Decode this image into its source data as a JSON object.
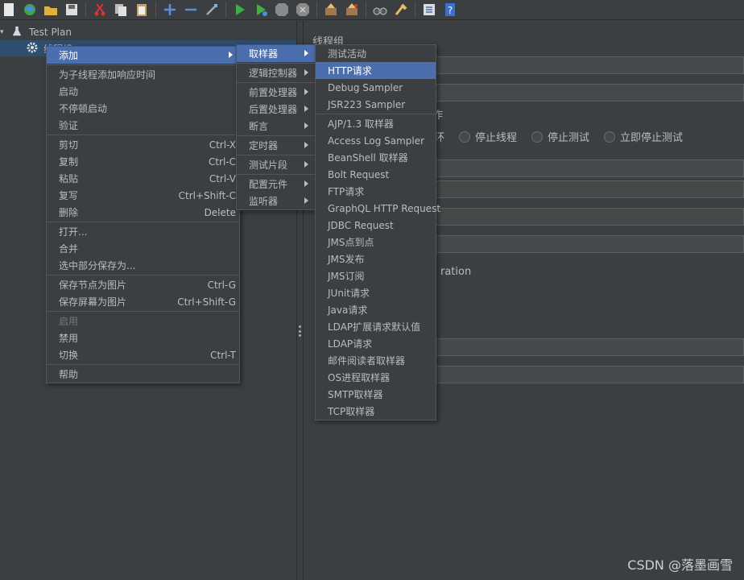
{
  "toolbar": {
    "icons": [
      "new-file-icon",
      "templates-icon",
      "open-folder-icon",
      "save-icon",
      "cut-icon",
      "copy-icon",
      "paste-icon",
      "expand-icon",
      "collapse-icon",
      "toggle-icon",
      "start-icon",
      "start-no-pause-icon",
      "stop-icon",
      "shutdown-icon",
      "clear-icon",
      "clear-all-icon",
      "search-icon",
      "reset-search-icon",
      "function-helper-icon",
      "help-icon"
    ]
  },
  "tree": {
    "test_plan": "Test Plan",
    "thread_group": "线程组"
  },
  "right_panel": {
    "title": "线程组",
    "frag_action": "作",
    "frag_loop": "程循环",
    "frag_duration": "ration",
    "radios": [
      "停止线程",
      "停止测试",
      "立即停止测试"
    ]
  },
  "context_menu": {
    "items": [
      {
        "label": "添加",
        "submenu": true,
        "active": true
      },
      {
        "sep": true
      },
      {
        "label": "为子线程添加响应时间"
      },
      {
        "label": "启动"
      },
      {
        "label": "不停顿启动"
      },
      {
        "label": "验证"
      },
      {
        "sep": true
      },
      {
        "label": "剪切",
        "shortcut": "Ctrl-X"
      },
      {
        "label": "复制",
        "shortcut": "Ctrl-C"
      },
      {
        "label": "粘贴",
        "shortcut": "Ctrl-V"
      },
      {
        "label": "复写",
        "shortcut": "Ctrl+Shift-C"
      },
      {
        "label": "删除",
        "shortcut": "Delete"
      },
      {
        "sep": true
      },
      {
        "label": "打开..."
      },
      {
        "label": "合并"
      },
      {
        "label": "选中部分保存为..."
      },
      {
        "sep": true
      },
      {
        "label": "保存节点为图片",
        "shortcut": "Ctrl-G"
      },
      {
        "label": "保存屏幕为图片",
        "shortcut": "Ctrl+Shift-G"
      },
      {
        "sep": true
      },
      {
        "label": "启用",
        "disabled": true
      },
      {
        "label": "禁用"
      },
      {
        "label": "切换",
        "shortcut": "Ctrl-T"
      },
      {
        "sep": true
      },
      {
        "label": "帮助"
      }
    ]
  },
  "add_menu": {
    "items": [
      {
        "label": "取样器",
        "submenu": true,
        "active": true
      },
      {
        "sep": true
      },
      {
        "label": "逻辑控制器",
        "submenu": true
      },
      {
        "sep": true
      },
      {
        "label": "前置处理器",
        "submenu": true
      },
      {
        "label": "后置处理器",
        "submenu": true
      },
      {
        "label": "断言",
        "submenu": true
      },
      {
        "sep": true
      },
      {
        "label": "定时器",
        "submenu": true
      },
      {
        "sep": true
      },
      {
        "label": "测试片段",
        "submenu": true
      },
      {
        "sep": true
      },
      {
        "label": "配置元件",
        "submenu": true
      },
      {
        "label": "监听器",
        "submenu": true
      }
    ]
  },
  "sampler_menu": {
    "items": [
      {
        "label": "测试活动"
      },
      {
        "label": "HTTP请求",
        "active": true
      },
      {
        "label": "Debug Sampler"
      },
      {
        "label": "JSR223 Sampler"
      },
      {
        "sep": true
      },
      {
        "label": "AJP/1.3 取样器"
      },
      {
        "label": "Access Log Sampler"
      },
      {
        "label": "BeanShell 取样器"
      },
      {
        "label": "Bolt Request"
      },
      {
        "label": "FTP请求"
      },
      {
        "label": "GraphQL HTTP Request"
      },
      {
        "label": "JDBC Request"
      },
      {
        "label": "JMS点到点"
      },
      {
        "label": "JMS发布"
      },
      {
        "label": "JMS订阅"
      },
      {
        "label": "JUnit请求"
      },
      {
        "label": "Java请求"
      },
      {
        "label": "LDAP扩展请求默认值"
      },
      {
        "label": "LDAP请求"
      },
      {
        "label": "邮件阅读者取样器"
      },
      {
        "label": "OS进程取样器"
      },
      {
        "label": "SMTP取样器"
      },
      {
        "label": "TCP取样器"
      }
    ]
  },
  "watermark": "CSDN @落墨画雪",
  "colors": {
    "background": "#3c3f41",
    "menu_highlight": "#4b6eaf",
    "tree_selection": "#2f4d6e"
  }
}
